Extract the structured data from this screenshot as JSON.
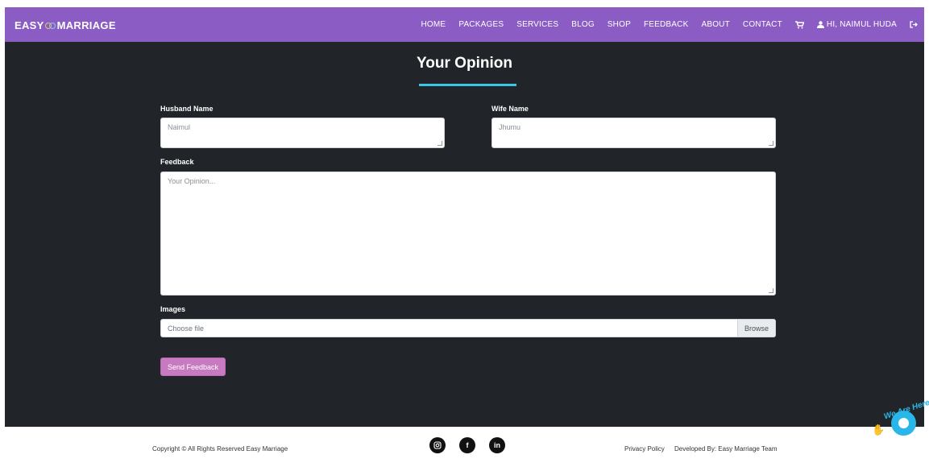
{
  "navbar": {
    "brand_left": "EASY",
    "brand_right": "MARRIAGE",
    "links": [
      "HOME",
      "PACKAGES",
      "SERVICES",
      "BLOG",
      "SHOP",
      "FEEDBACK",
      "ABOUT",
      "CONTACT"
    ],
    "user_greeting": "HI, NAIMUL HUDA"
  },
  "form": {
    "title": "Your Opinion",
    "husband_label": "Husband Name",
    "husband_value": "Naimul",
    "wife_label": "Wife Name",
    "wife_value": "Jhumu",
    "feedback_label": "Feedback",
    "feedback_placeholder": "Your Opinion...",
    "images_label": "Images",
    "file_placeholder": "Choose file",
    "browse_label": "Browse",
    "submit_label": "Send Feedback"
  },
  "footer": {
    "copyright": "Copyright © All Rights Reserved Easy Marriage",
    "social_icons": [
      "instagram-icon",
      "facebook-icon",
      "linkedin-icon"
    ],
    "privacy": "Privacy Policy",
    "developed_by": "Developed By: Easy Marriage Team"
  },
  "chat_widget": {
    "text": "We Are Here!"
  },
  "colors": {
    "navbar": "#8a5cc4",
    "background": "#212529",
    "accent": "#3ec4e3",
    "submit_button": "#c77ac0"
  }
}
